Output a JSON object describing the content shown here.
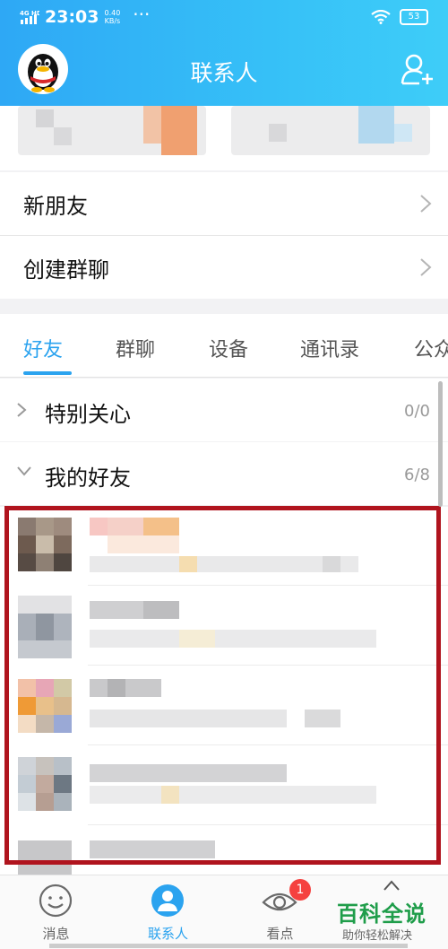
{
  "status_bar": {
    "network": "4G HD",
    "time": "23:03",
    "speed_value": "0.40",
    "speed_unit": "KB/s",
    "more": "···",
    "battery": "53"
  },
  "header": {
    "title": "联系人"
  },
  "menu": [
    {
      "label": "新朋友"
    },
    {
      "label": "创建群聊"
    }
  ],
  "tabs": [
    {
      "label": "好友",
      "active": true
    },
    {
      "label": "群聊"
    },
    {
      "label": "设备"
    },
    {
      "label": "通讯录"
    },
    {
      "label": "公众"
    }
  ],
  "groups": [
    {
      "label": "特别关心",
      "count": "0/0",
      "expanded": false
    },
    {
      "label": "我的好友",
      "count": "6/8",
      "expanded": true
    }
  ],
  "bottom_nav": [
    {
      "label": "消息",
      "icon": "message-smile-icon"
    },
    {
      "label": "联系人",
      "icon": "contacts-person-icon",
      "active": true
    },
    {
      "label": "看点",
      "icon": "eye-icon",
      "badge": "1"
    },
    {
      "label": "",
      "icon": "collapse-icon"
    }
  ],
  "watermark": {
    "main": "百科全说",
    "sub": "助你轻松解决"
  },
  "colors": {
    "accent": "#2ba3ef",
    "header": "#36b8f6",
    "highlight": "#b0141e",
    "badge": "#f5413f",
    "watermark": "#1f9d4a"
  }
}
